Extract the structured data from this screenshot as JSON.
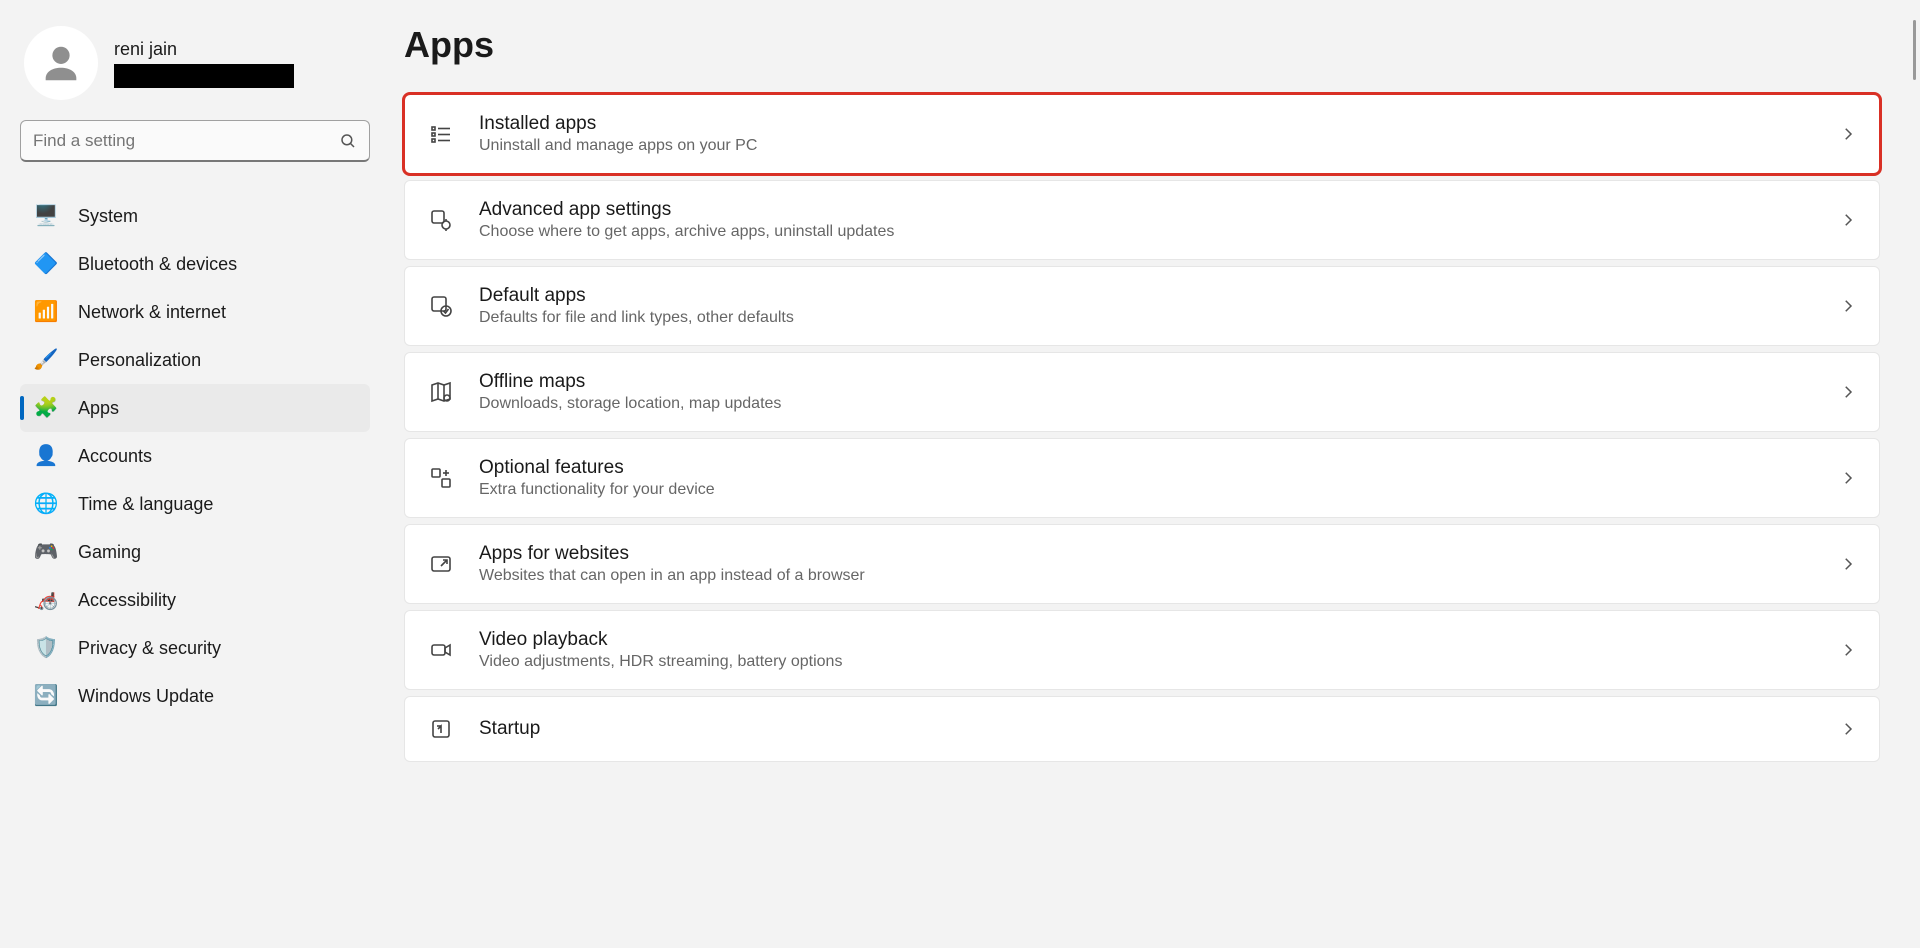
{
  "user": {
    "name": "reni jain"
  },
  "search": {
    "placeholder": "Find a setting"
  },
  "nav": {
    "items": [
      {
        "id": "system",
        "label": "System",
        "icon": "🖥️"
      },
      {
        "id": "bluetooth",
        "label": "Bluetooth & devices",
        "icon": "🔷"
      },
      {
        "id": "network",
        "label": "Network & internet",
        "icon": "📶"
      },
      {
        "id": "personalization",
        "label": "Personalization",
        "icon": "🖌️"
      },
      {
        "id": "apps",
        "label": "Apps",
        "icon": "🧩",
        "active": true
      },
      {
        "id": "accounts",
        "label": "Accounts",
        "icon": "👤"
      },
      {
        "id": "time",
        "label": "Time & language",
        "icon": "🌐"
      },
      {
        "id": "gaming",
        "label": "Gaming",
        "icon": "🎮"
      },
      {
        "id": "accessibility",
        "label": "Accessibility",
        "icon": "🦽"
      },
      {
        "id": "privacy",
        "label": "Privacy & security",
        "icon": "🛡️"
      },
      {
        "id": "update",
        "label": "Windows Update",
        "icon": "🔄"
      }
    ]
  },
  "page": {
    "title": "Apps",
    "cards": [
      {
        "id": "installed",
        "title": "Installed apps",
        "desc": "Uninstall and manage apps on your PC",
        "icon": "list",
        "highlight": true
      },
      {
        "id": "advanced",
        "title": "Advanced app settings",
        "desc": "Choose where to get apps, archive apps, uninstall updates",
        "icon": "gear-tile",
        "highlight": false
      },
      {
        "id": "defaults",
        "title": "Default apps",
        "desc": "Defaults for file and link types, other defaults",
        "icon": "check-tile",
        "highlight": false
      },
      {
        "id": "maps",
        "title": "Offline maps",
        "desc": "Downloads, storage location, map updates",
        "icon": "map",
        "highlight": false
      },
      {
        "id": "optional",
        "title": "Optional features",
        "desc": "Extra functionality for your device",
        "icon": "plus-tile",
        "highlight": false
      },
      {
        "id": "websites",
        "title": "Apps for websites",
        "desc": "Websites that can open in an app instead of a browser",
        "icon": "link-tile",
        "highlight": false
      },
      {
        "id": "video",
        "title": "Video playback",
        "desc": "Video adjustments, HDR streaming, battery options",
        "icon": "video",
        "highlight": false
      },
      {
        "id": "startup",
        "title": "Startup",
        "desc": "",
        "icon": "startup",
        "highlight": false
      }
    ]
  }
}
